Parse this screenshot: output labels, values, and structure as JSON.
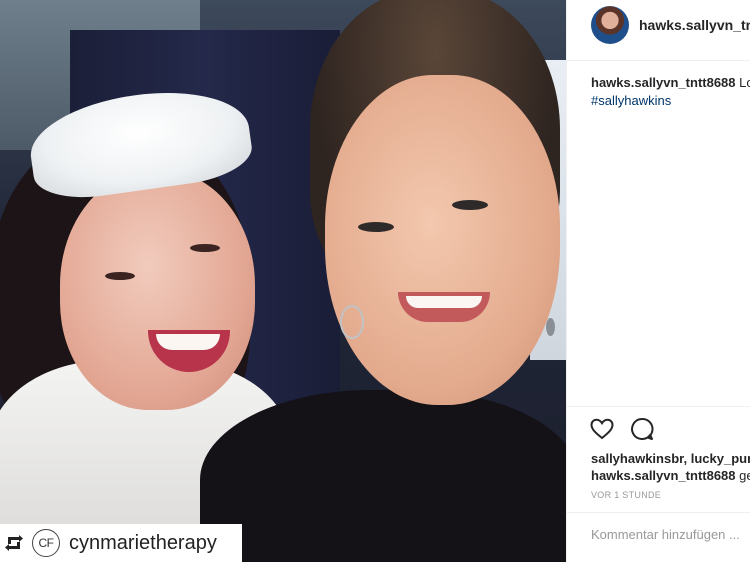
{
  "post": {
    "repost_username": "cynmarietherapy",
    "repost_logo_text": "CF"
  },
  "header": {
    "username": "hawks.sallyvn_tntt"
  },
  "caption": {
    "username": "hawks.sallyvn_tntt8688",
    "text": "Lov",
    "hashtag": "#sallyhawkins"
  },
  "likes": {
    "names": "sallyhawkinsbr, lucky_purs",
    "line2_user": "hawks.sallyvn_tntt8688",
    "line2_text": "ge"
  },
  "timestamp": "VOR 1 STUNDE",
  "comment": {
    "placeholder": "Kommentar hinzufügen ..."
  },
  "icons": [
    "repost-icon",
    "heart-icon",
    "comment-icon"
  ]
}
